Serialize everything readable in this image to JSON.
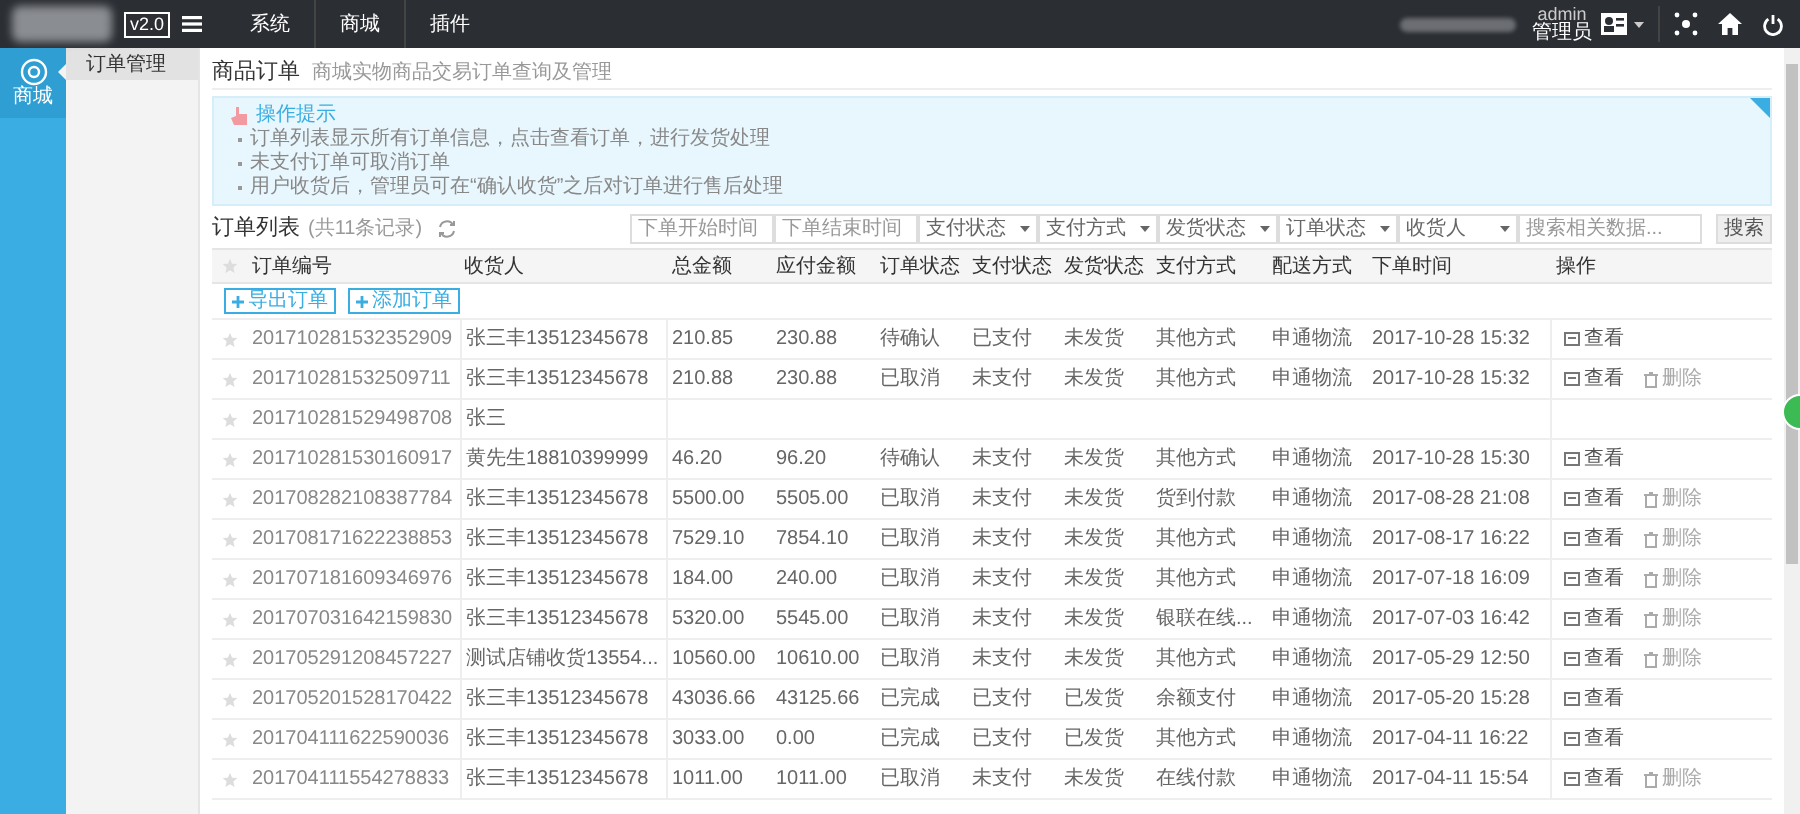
{
  "top_bar": {
    "version": "v2.0",
    "nav": [
      {
        "label": "系统",
        "selected": false
      },
      {
        "label": "商城",
        "selected": false
      },
      {
        "label": "插件",
        "selected": false
      }
    ],
    "user": {
      "name": "admin",
      "role": "管理员"
    }
  },
  "sidebar": {
    "items": [
      {
        "label": "商城",
        "selected": true
      }
    ]
  },
  "subnav": {
    "items": [
      {
        "label": "订单管理",
        "selected": true
      }
    ]
  },
  "page": {
    "title": "商品订单",
    "subtitle": "商城实物商品交易订单查询及管理"
  },
  "tips": {
    "title": "操作提示",
    "items": [
      "订单列表显示所有订单信息，点击查看订单，进行发货处理",
      "未支付订单可取消订单",
      "用户收货后，管理员可在“确认收货”之后对订单进行售后处理"
    ]
  },
  "order_list": {
    "title": "订单列表",
    "count": "(共11条记录)",
    "filters": [
      {
        "kind": "input",
        "placeholder": "下单开始时间"
      },
      {
        "kind": "input",
        "placeholder": "下单结束时间"
      },
      {
        "kind": "select",
        "label": "支付状态"
      },
      {
        "kind": "select",
        "label": "支付方式"
      },
      {
        "kind": "select",
        "label": "发货状态"
      },
      {
        "kind": "select",
        "label": "订单状态"
      },
      {
        "kind": "select",
        "label": "收货人"
      },
      {
        "kind": "input",
        "placeholder": "搜索相关数据..."
      }
    ],
    "search_button": "搜索"
  },
  "table": {
    "columns": [
      "订单编号",
      "收货人",
      "总金额",
      "应付金额",
      "订单状态",
      "支付状态",
      "发货状态",
      "支付方式",
      "配送方式",
      "下单时间",
      "操作"
    ],
    "actions": [
      "导出订单",
      "添加订单"
    ],
    "rows": [
      {
        "cells": [
          "201710281532352909",
          "张三丰13512345678",
          "210.85",
          "230.88",
          "待确认",
          "已支付",
          "未发货",
          "其他方式",
          "申通物流",
          "2017-10-28 15:32"
        ],
        "ops": [
          {
            "kind": "view",
            "label": "查看"
          }
        ]
      },
      {
        "cells": [
          "201710281532509711",
          "张三丰13512345678",
          "210.88",
          "230.88",
          "已取消",
          "未支付",
          "未发货",
          "其他方式",
          "申通物流",
          "2017-10-28 15:32"
        ],
        "ops": [
          {
            "kind": "view",
            "label": "查看"
          },
          {
            "kind": "delete",
            "label": "删除"
          }
        ]
      },
      {
        "cells": [
          "201710281529498708",
          "张三"
        ],
        "ops": []
      },
      {
        "cells": [
          "201710281530160917",
          "黄先生18810399999",
          "46.20",
          "96.20",
          "待确认",
          "未支付",
          "未发货",
          "其他方式",
          "申通物流",
          "2017-10-28 15:30"
        ],
        "ops": [
          {
            "kind": "view",
            "label": "查看"
          }
        ]
      },
      {
        "cells": [
          "201708282108387784",
          "张三丰13512345678",
          "5500.00",
          "5505.00",
          "已取消",
          "未支付",
          "未发货",
          "货到付款",
          "申通物流",
          "2017-08-28 21:08"
        ],
        "ops": [
          {
            "kind": "view",
            "label": "查看"
          },
          {
            "kind": "delete",
            "label": "删除"
          }
        ]
      },
      {
        "cells": [
          "201708171622238853",
          "张三丰13512345678",
          "7529.10",
          "7854.10",
          "已取消",
          "未支付",
          "未发货",
          "其他方式",
          "申通物流",
          "2017-08-17 16:22"
        ],
        "ops": [
          {
            "kind": "view",
            "label": "查看"
          },
          {
            "kind": "delete",
            "label": "删除"
          }
        ]
      },
      {
        "cells": [
          "201707181609346976",
          "张三丰13512345678",
          "184.00",
          "240.00",
          "已取消",
          "未支付",
          "未发货",
          "其他方式",
          "申通物流",
          "2017-07-18 16:09"
        ],
        "ops": [
          {
            "kind": "view",
            "label": "查看"
          },
          {
            "kind": "delete",
            "label": "删除"
          }
        ]
      },
      {
        "cells": [
          "201707031642159830",
          "张三丰13512345678",
          "5320.00",
          "5545.00",
          "已取消",
          "未支付",
          "未发货",
          "银联在线...",
          "申通物流",
          "2017-07-03 16:42"
        ],
        "ops": [
          {
            "kind": "view",
            "label": "查看"
          },
          {
            "kind": "delete",
            "label": "删除"
          }
        ]
      },
      {
        "cells": [
          "201705291208457227",
          "测试店铺收货13554...",
          "10560.00",
          "10610.00",
          "已取消",
          "未支付",
          "未发货",
          "其他方式",
          "申通物流",
          "2017-05-29 12:50"
        ],
        "ops": [
          {
            "kind": "view",
            "label": "查看"
          },
          {
            "kind": "delete",
            "label": "删除"
          }
        ]
      },
      {
        "cells": [
          "201705201528170422",
          "张三丰13512345678",
          "43036.66",
          "43125.66",
          "已完成",
          "已支付",
          "已发货",
          "余额支付",
          "申通物流",
          "2017-05-20 15:28"
        ],
        "ops": [
          {
            "kind": "view",
            "label": "查看"
          }
        ]
      },
      {
        "cells": [
          "201704111622590036",
          "张三丰13512345678",
          "3033.00",
          "0.00",
          "已完成",
          "已支付",
          "已发货",
          "其他方式",
          "申通物流",
          "2017-04-11 16:22"
        ],
        "ops": [
          {
            "kind": "view",
            "label": "查看"
          }
        ]
      },
      {
        "cells": [
          "201704111554278833",
          "张三丰13512345678",
          "1011.00",
          "1011.00",
          "已取消",
          "未支付",
          "未发货",
          "在线付款",
          "申通物流",
          "2017-04-11 15:54"
        ],
        "ops": [
          {
            "kind": "view",
            "label": "查看"
          },
          {
            "kind": "delete",
            "label": "删除"
          }
        ]
      }
    ]
  }
}
